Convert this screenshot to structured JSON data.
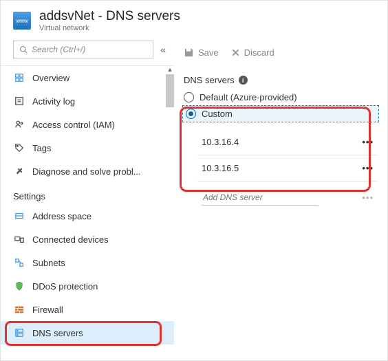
{
  "header": {
    "title": "addsvNet - DNS servers",
    "subtitle": "Virtual network",
    "icon_label": "www"
  },
  "sidebar": {
    "search_placeholder": "Search (Ctrl+/)",
    "items": [
      {
        "label": "Overview",
        "icon": "overview"
      },
      {
        "label": "Activity log",
        "icon": "log"
      },
      {
        "label": "Access control (IAM)",
        "icon": "iam"
      },
      {
        "label": "Tags",
        "icon": "tag"
      },
      {
        "label": "Diagnose and solve probl...",
        "icon": "diagnose"
      }
    ],
    "section_label": "Settings",
    "settings_items": [
      {
        "label": "Address space",
        "icon": "address"
      },
      {
        "label": "Connected devices",
        "icon": "devices"
      },
      {
        "label": "Subnets",
        "icon": "subnets"
      },
      {
        "label": "DDoS protection",
        "icon": "shield"
      },
      {
        "label": "Firewall",
        "icon": "firewall"
      },
      {
        "label": "DNS servers",
        "icon": "dns",
        "selected": true
      }
    ]
  },
  "toolbar": {
    "save_label": "Save",
    "discard_label": "Discard"
  },
  "dns": {
    "section_label": "DNS servers",
    "option_default": "Default (Azure-provided)",
    "option_custom": "Custom",
    "servers": [
      "10.3.16.4",
      "10.3.16.5"
    ],
    "add_placeholder": "Add DNS server"
  }
}
